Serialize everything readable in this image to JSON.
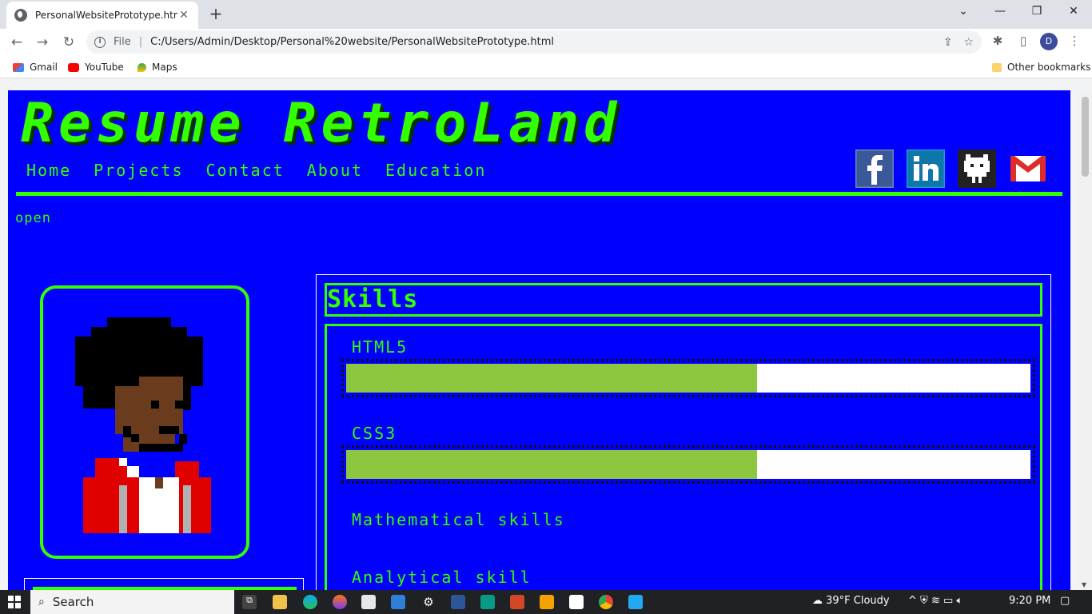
{
  "browser": {
    "tab_title": "PersonalWebsitePrototype.html",
    "tab_close": "✕",
    "new_tab": "+",
    "address_scheme": "File",
    "address_url": "C:/Users/Admin/Desktop/Personal%20website/PersonalWebsitePrototype.html",
    "profile_initial": "D",
    "bookmarks": [
      "Gmail",
      "YouTube",
      "Maps"
    ],
    "other_bookmarks": "Other bookmarks"
  },
  "site": {
    "title": "Resume RetroLand",
    "nav": [
      "Home",
      "Projects",
      "Contact",
      "About",
      "Education"
    ],
    "open_label": "open",
    "skills_heading": "Skills",
    "skills": [
      {
        "name": "HTML5",
        "progress": 0.6
      },
      {
        "name": "CSS3",
        "progress": 0.6
      },
      {
        "name": "Mathematical skills"
      },
      {
        "name": "Analytical skill"
      }
    ],
    "social_icons": [
      "facebook-icon",
      "linkedin-icon",
      "github-icon",
      "gmail-icon"
    ],
    "colors": {
      "page_bg": "#0000ff",
      "accent": "#33ff00",
      "bar_fill": "#8dc63f"
    }
  },
  "taskbar": {
    "search_placeholder": "Search",
    "weather": "39°F  Cloudy",
    "time": "9:20 PM"
  }
}
